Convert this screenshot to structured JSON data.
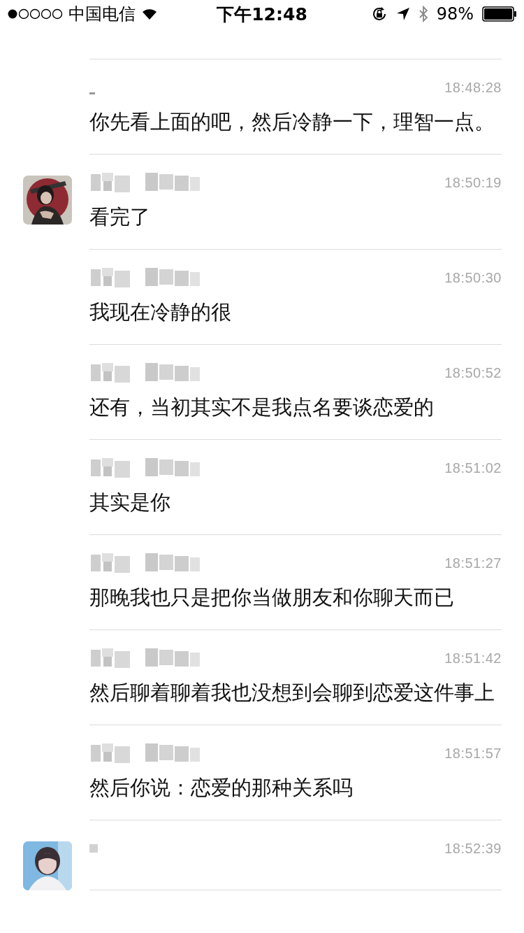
{
  "status_bar": {
    "carrier": "中国电信",
    "time": "下午12:48",
    "battery": "98%"
  },
  "messages": [
    {
      "kind": "cut",
      "has_avatar": false
    },
    {
      "kind": "dash",
      "has_avatar": false,
      "time": "18:48:28",
      "text": "你先看上面的吧，然后冷静一下，理智一点。"
    },
    {
      "kind": "named",
      "has_avatar": true,
      "time": "18:50:19",
      "text": "看完了"
    },
    {
      "kind": "named",
      "has_avatar": false,
      "time": "18:50:30",
      "text": "我现在冷静的很"
    },
    {
      "kind": "named",
      "has_avatar": false,
      "time": "18:50:52",
      "text": "还有，当初其实不是我点名要谈恋爱的"
    },
    {
      "kind": "named",
      "has_avatar": false,
      "time": "18:51:02",
      "text": "其实是你"
    },
    {
      "kind": "named",
      "has_avatar": false,
      "time": "18:51:27",
      "text": "那晚我也只是把你当做朋友和你聊天而已"
    },
    {
      "kind": "named",
      "has_avatar": false,
      "time": "18:51:42",
      "text": "然后聊着聊着我也没想到会聊到恋爱这件事上"
    },
    {
      "kind": "named",
      "has_avatar": false,
      "time": "18:51:57",
      "text": "然后你说：恋爱的那种关系吗"
    },
    {
      "kind": "short",
      "has_avatar": true,
      "time": "18:52:39"
    }
  ]
}
